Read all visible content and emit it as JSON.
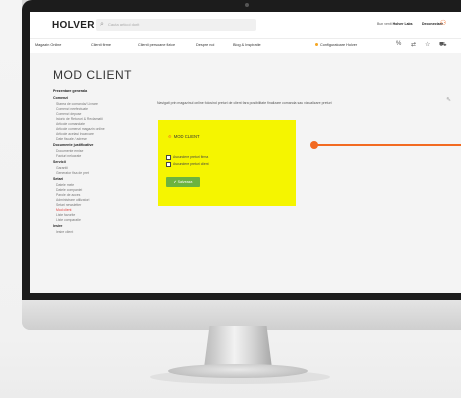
{
  "header": {
    "logo_text": "HOLVER",
    "search_placeholder": "Cauta articol dorit",
    "welcome_prefix": "Bun venit",
    "user_name": "Holver Labs",
    "logout_label": "Deconectare"
  },
  "nav": {
    "items": [
      "Magazin Online",
      "Clienti firme",
      "Clienti persoane fizice",
      "Despre noi",
      "Blog & Inspiratie"
    ],
    "configurator_label": "Configuratoare Holver"
  },
  "page": {
    "title": "MOD CLIENT",
    "description": "Navigati prin magazinul online folosind preturi de client fara posibilitate finalizare comanda sau vizualizare preturi",
    "panel_title": "MOD CLIENT",
    "checkbox_1": "Ascundere preturi firma",
    "checkbox_2": "Ascundere preturi client",
    "save_label": "Salveaza"
  },
  "sidebar": [
    {
      "heading": "Prezentare generala",
      "items": []
    },
    {
      "heading": "Comenzi",
      "items": [
        "Starea de comanda/ Livrare",
        "Comenzi neefectuate",
        "Comenzi depuse",
        "Istoric de Retururi & Reclamatii",
        "Articole comandate",
        "Articole comenzi magazin online",
        "Articole acelasi Incarcare",
        "Date fiscale / adrese"
      ]
    },
    {
      "heading": "Documente justificative",
      "items": [
        "Documente emise",
        "Facturi nelucrate"
      ]
    },
    {
      "heading": "Servicii",
      "items": [
        "Garantii",
        "Generator fisa de pret"
      ]
    },
    {
      "heading": "Setari",
      "items": [
        "Datele mele",
        "Datele companiei",
        "Parole de acces",
        "Administrare utilizatori",
        "Setari newsletter",
        "Mod client",
        "Liste favorite",
        "Liste comparatie"
      ]
    },
    {
      "heading": "Iesire",
      "items": [
        "Iesire client"
      ]
    }
  ],
  "active_item": "Mod client",
  "colors": {
    "accent": "#f26a21",
    "highlight": "#f5f500",
    "save_button": "#6cb33f",
    "brand_red": "#e53935"
  }
}
